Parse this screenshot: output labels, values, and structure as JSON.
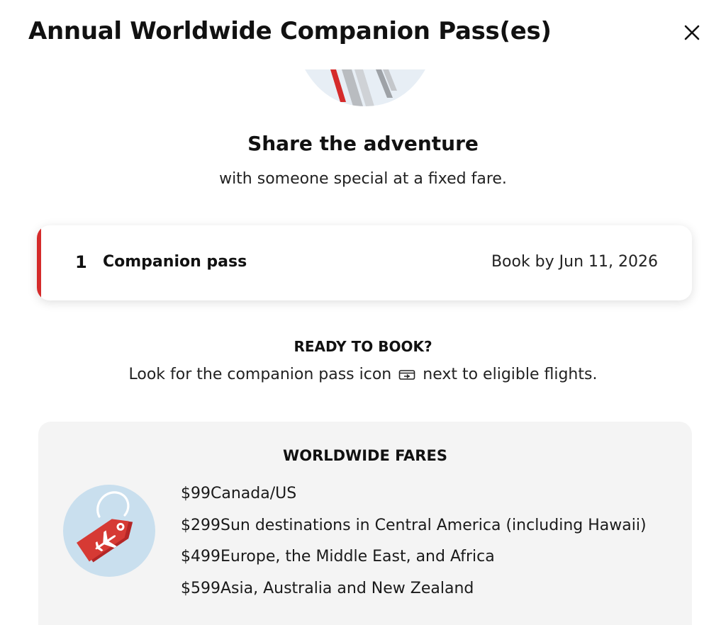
{
  "header": {
    "title": "Annual Worldwide Companion Pass(es)",
    "close_icon": "close-icon"
  },
  "hero": {
    "title": "Share the adventure",
    "subtitle": "with someone special at a fixed fare."
  },
  "pass_card": {
    "count": "1",
    "label": "Companion pass",
    "book_by": "Book by Jun 11, 2026",
    "accent_color": "#d52b2b"
  },
  "ready": {
    "heading": "READY TO BOOK?",
    "text_before": "Look for the companion pass icon",
    "icon": "companion-pass-icon",
    "text_after": "next to eligible flights."
  },
  "fares": {
    "heading": "WORLDWIDE FARES",
    "items": [
      {
        "price": "$99",
        "destination": "Canada/US"
      },
      {
        "price": "$299",
        "destination": "Sun destinations in Central America (including Hawaii)"
      },
      {
        "price": "$499",
        "destination": "Europe, the Middle East, and Africa"
      },
      {
        "price": "$599",
        "destination": "Asia, Australia and New Zealand"
      }
    ]
  }
}
